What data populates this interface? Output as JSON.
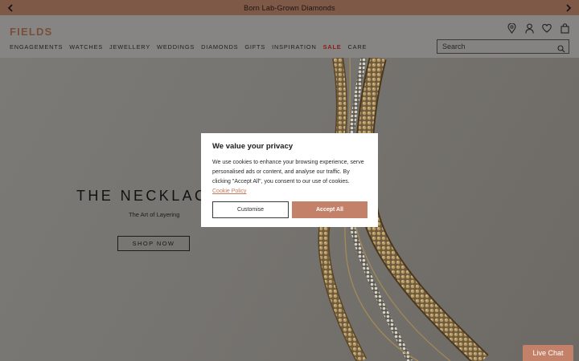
{
  "announcement": {
    "text": "Born Lab-Grown Diamonds",
    "prev_icon": "chevron-left-icon",
    "next_icon": "chevron-right-icon"
  },
  "header": {
    "logo": "FIELDS",
    "nav": [
      {
        "label": "ENGAGEMENTS"
      },
      {
        "label": "WATCHES"
      },
      {
        "label": "JEWELLERY"
      },
      {
        "label": "WEDDINGS"
      },
      {
        "label": "DIAMONDS"
      },
      {
        "label": "GIFTS"
      },
      {
        "label": "INSPIRATION"
      },
      {
        "label": "SALE"
      },
      {
        "label": "CARE"
      }
    ],
    "icons": [
      "location-pin-icon",
      "account-icon",
      "wishlist-heart-icon",
      "shopping-bag-icon"
    ],
    "search": {
      "placeholder": "Search",
      "value": ""
    }
  },
  "hero": {
    "title": "THE NECKLACE E",
    "subtitle": "The Art of Layering",
    "cta": "SHOP NOW"
  },
  "cookie_modal": {
    "title": "We value your privacy",
    "body": "We use cookies to enhance your browsing experience, serve personalised ads or content, and analyse our traffic. By clicking \"Accept All\", you consent to our use of cookies.",
    "link": "Cookie Policy",
    "customise": "Customise",
    "accept": "Accept All"
  },
  "live_chat": "Live Chat",
  "colors": {
    "brand": "#7a4e38",
    "accent": "#c4816a",
    "sale": "#8a1c12",
    "announcement_bg": "#7e5947"
  }
}
